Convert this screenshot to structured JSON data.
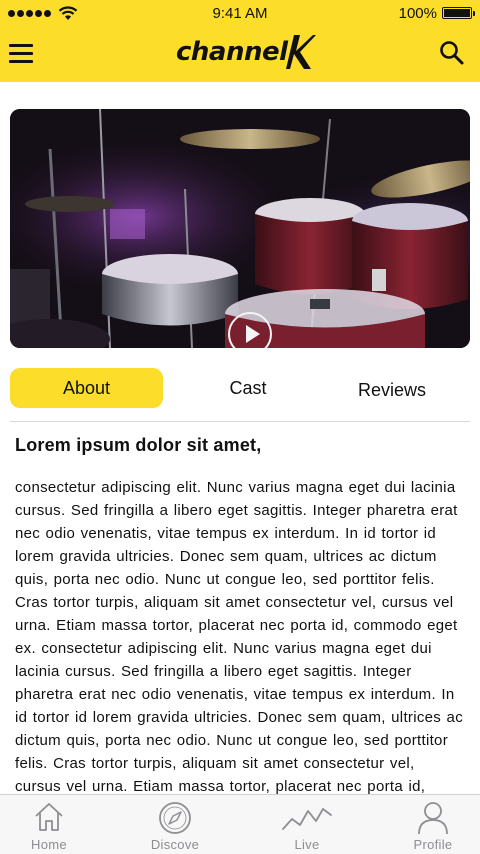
{
  "status_bar": {
    "time": "9:41 AM",
    "battery": "100%",
    "signal_icon": "signal-dots-icon",
    "wifi_icon": "wifi-icon",
    "battery_icon": "battery-icon"
  },
  "header": {
    "logo_text": "channel",
    "menu_icon": "hamburger-menu-icon",
    "search_icon": "search-icon",
    "background_color": "#fcdd2a"
  },
  "hero": {
    "play_icon": "play-icon"
  },
  "tabs": [
    {
      "label": "About",
      "active": true
    },
    {
      "label": "Cast",
      "active": false
    },
    {
      "label": "Reviews",
      "active": false
    }
  ],
  "article": {
    "title": "Lorem ipsum dolor sit amet,",
    "lines": [
      "consectetur adipiscing elit. Nunc varius magna eget dui lacinia",
      "cursus. Sed fringilla a libero eget sagittis. Integer pharetra erat",
      "nec odio venenatis, vitae tempus ex interdum. In id tortor id",
      "lorem gravida ultricies. Donec sem quam, ultrices ac dictum",
      "quis, porta nec odio. Nunc ut congue leo, sed porttitor felis.",
      "Cras tortor turpis, aliquam sit amet consectetur vel, cursus vel",
      "urna. Etiam massa tortor, placerat nec porta id, commodo eget",
      "ex. consectetur adipiscing elit. Nunc varius magna eget dui",
      "lacinia cursus. Sed fringilla a libero eget sagittis. Integer",
      "pharetra erat nec odio venenatis, vitae tempus ex interdum. In",
      "id tortor id lorem gravida ultricies. Donec sem quam, ultrices ac",
      "dictum quis, porta nec odio. Nunc ut congue leo, sed porttitor",
      "felis. Cras tortor turpis, aliquam sit amet consectetur vel,",
      "cursus vel urna. Etiam massa tortor, placerat nec porta id,"
    ]
  },
  "tabbar": [
    {
      "label": "Home",
      "icon": "home-icon"
    },
    {
      "label": "Discove",
      "icon": "compass-icon"
    },
    {
      "label": "Live",
      "icon": "activity-graph-icon"
    },
    {
      "label": "Profile",
      "icon": "user-icon"
    }
  ],
  "colors": {
    "accent": "#fcdd2a",
    "tabbar_inactive": "#8e8e93"
  }
}
